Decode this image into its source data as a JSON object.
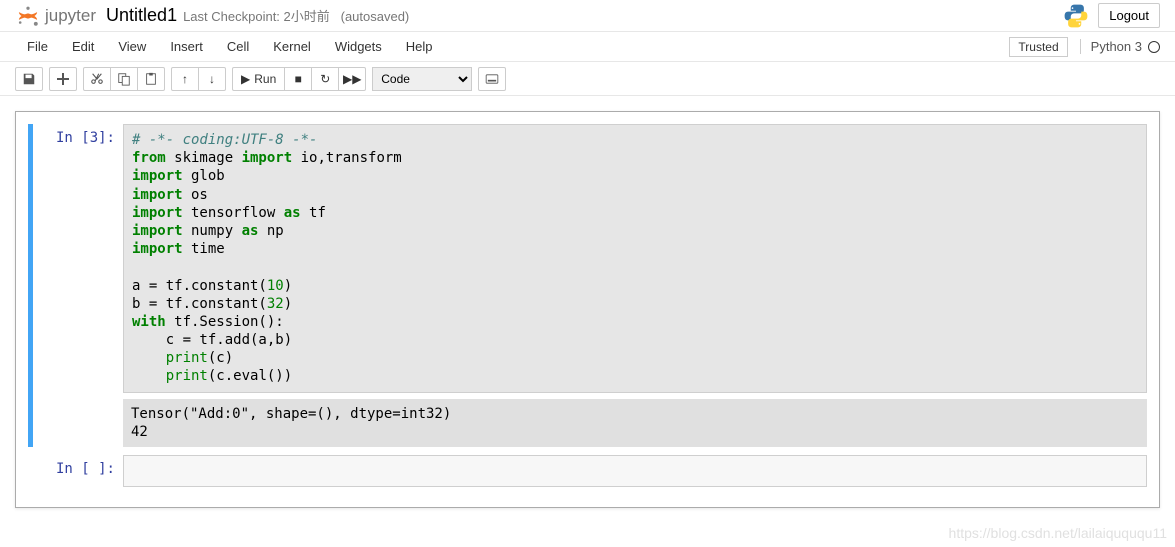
{
  "header": {
    "logo_text": "jupyter",
    "title": "Untitled1",
    "checkpoint": "Last Checkpoint: 2小时前",
    "autosave": "(autosaved)",
    "logout": "Logout"
  },
  "menu": {
    "items": [
      "File",
      "Edit",
      "View",
      "Insert",
      "Cell",
      "Kernel",
      "Widgets",
      "Help"
    ],
    "trusted": "Trusted",
    "kernel": "Python 3"
  },
  "toolbar": {
    "run_label": "Run",
    "cell_type": "Code"
  },
  "cells": [
    {
      "prompt": "In  [3]:",
      "output": "Tensor(\"Add:0\", shape=(), dtype=int32)\n42"
    },
    {
      "prompt": "In  [ ]:"
    }
  ],
  "code_lines": {
    "l0": "# -*- coding:UTF-8 -*-",
    "l1a": "from",
    "l1b": " skimage ",
    "l1c": "import",
    "l1d": " io,transform",
    "l2a": "import",
    "l2b": " glob",
    "l3a": "import",
    "l3b": " os",
    "l4a": "import",
    "l4b": " tensorflow ",
    "l4c": "as",
    "l4d": " tf",
    "l5a": "import",
    "l5b": " numpy ",
    "l5c": "as",
    "l5d": " np",
    "l6a": "import",
    "l6b": " time",
    "l7": "",
    "l8a": "a = tf.constant(",
    "l8b": "10",
    "l8c": ")",
    "l9a": "b = tf.constant(",
    "l9b": "32",
    "l9c": ")",
    "l10a": "with",
    "l10b": " tf.Session():",
    "l11": "    c = tf.add(a,b)",
    "l12a": "    ",
    "l12b": "print",
    "l12c": "(c)",
    "l13a": "    ",
    "l13b": "print",
    "l13c": "(c.eval())"
  },
  "watermark": "https://blog.csdn.net/lailaiquququ11"
}
